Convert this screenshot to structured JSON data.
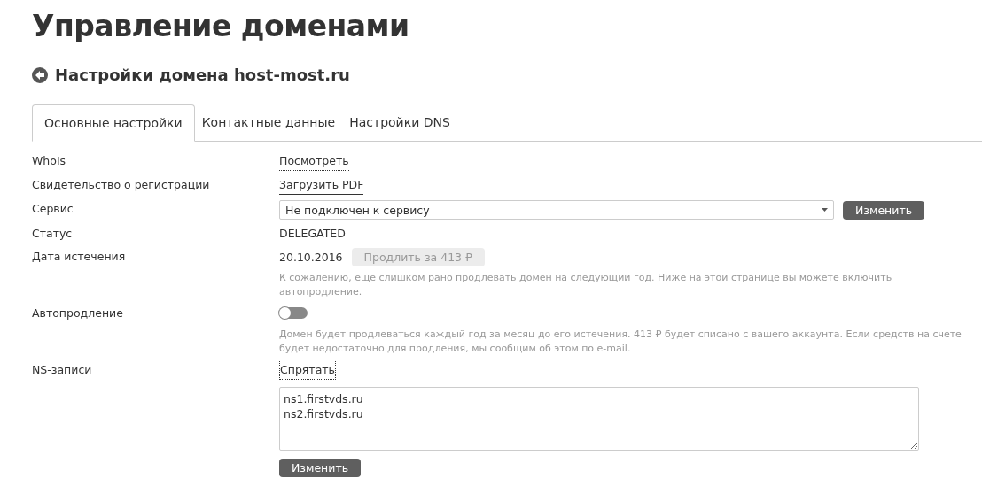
{
  "page_title": "Управление доменами",
  "subtitle": "Настройки домена host-most.ru",
  "tabs": [
    {
      "label": "Основные настройки",
      "selected": true
    },
    {
      "label": "Контактные данные",
      "selected": false
    },
    {
      "label": "Настройки DNS",
      "selected": false
    }
  ],
  "rows": [
    {
      "kind": "link",
      "label": "WhoIs",
      "link": "Посмотреть",
      "dotted": true
    },
    {
      "kind": "link",
      "label": "Свидетельство о регистрации",
      "link": "Загрузить PDF",
      "dotted": false
    },
    {
      "kind": "select",
      "label": "Сервис",
      "value": "Не подключен к сервису",
      "button": "Изменить"
    },
    {
      "kind": "text",
      "label": "Статус",
      "value": "DELEGATED"
    },
    {
      "kind": "date",
      "label": "Дата истечения",
      "value": "20.10.2016",
      "button": "Продлить за 413 ₽",
      "disabled": true,
      "hint": "К сожалению, еще слишком рано продлевать домен на следующий год. Ниже на этой странице вы можете включить автопродление."
    },
    {
      "kind": "toggle",
      "label": "Автопродление",
      "on": false,
      "hint": "Домен будет продлеваться каждый год за месяц до его истечения. 413 ₽ будет списано с вашего аккаунта. Если средств на счете будет недостаточно для продления, мы сообщим об этом по e-mail."
    },
    {
      "kind": "ns",
      "label": "NS-записи",
      "link": "Спрятать",
      "lines": [
        "ns1.firstvds.ru",
        "ns2.firstvds.ru"
      ],
      "button": "Изменить"
    }
  ]
}
